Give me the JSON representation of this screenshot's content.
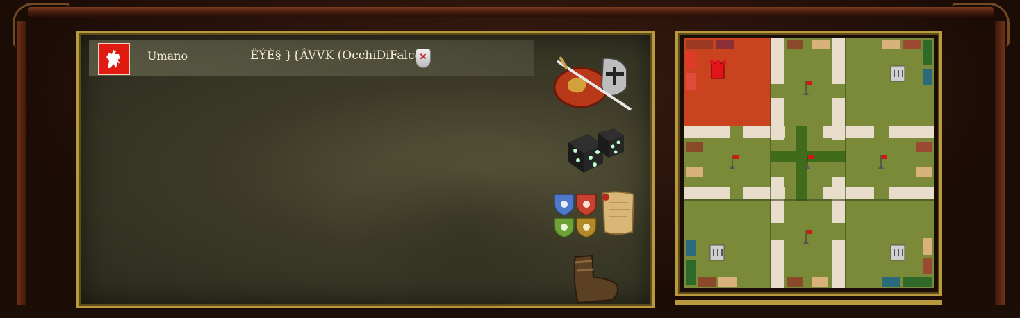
{
  "player": {
    "type": "Umano",
    "name": "ËÝÈ§ }{ÂVVK (OcchiDiFalco)"
  },
  "colors": {
    "player_red": "#e11a12",
    "map_grass": "#7a8a38",
    "map_road": "#e8dccb",
    "player_territory": "#c8431e",
    "frame_gold": "#b89a3c"
  },
  "icons": {
    "player_crest": "lion-rampant-icon",
    "remove": "remove-shield-icon",
    "army": "knight-helmet-sword-icon",
    "random": "dice-icon",
    "factions": "faction-shields-icon",
    "scroll": "parchment-scroll-icon",
    "boot": "boot-icon",
    "castle": "castle-icon",
    "flag": "flag-icon"
  }
}
